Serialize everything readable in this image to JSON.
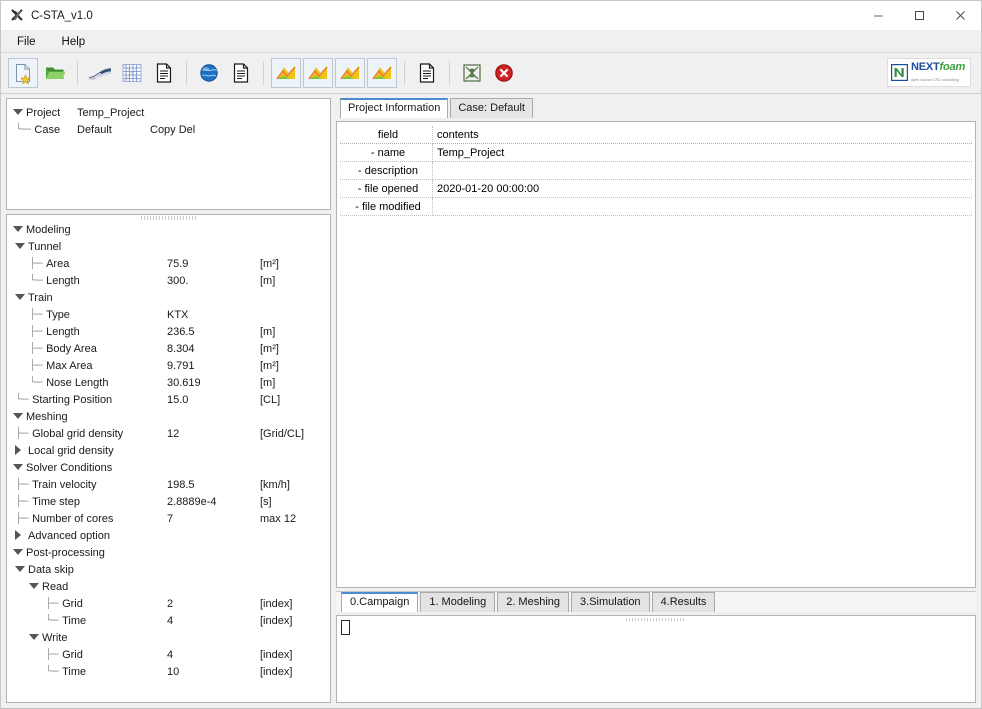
{
  "window": {
    "title": "C-STA_v1.0",
    "app_icon": "app-icon",
    "minimize": "minimize-icon",
    "maximize": "maximize-icon",
    "close": "close-icon"
  },
  "menubar": {
    "items": [
      {
        "label": "File"
      },
      {
        "label": "Help"
      }
    ]
  },
  "toolbar": {
    "buttons": [
      {
        "icon": "new-project-icon",
        "title": "New"
      },
      {
        "icon": "open-folder-icon",
        "title": "Open"
      },
      {
        "icon": "train-icon",
        "title": "Train"
      },
      {
        "icon": "mesh-grid-icon",
        "title": "Mesh"
      },
      {
        "icon": "document-icon",
        "title": "Document"
      },
      {
        "icon": "globe-icon",
        "title": "Run"
      },
      {
        "icon": "document-icon",
        "title": "Report"
      },
      {
        "icon": "chart-icon",
        "title": "Plot 1"
      },
      {
        "icon": "chart-icon",
        "title": "Plot 2"
      },
      {
        "icon": "chart-icon",
        "title": "Plot 3"
      },
      {
        "icon": "chart-icon",
        "title": "Plot 4"
      },
      {
        "icon": "document-icon",
        "title": "Log"
      },
      {
        "icon": "paraview-icon",
        "title": "ParaView"
      },
      {
        "icon": "stop-icon",
        "title": "Stop"
      }
    ],
    "brand": {
      "name_1": "NEXT",
      "name_2": "foam",
      "tagline": "open source CFD consulting"
    }
  },
  "project_tree": {
    "rows": [
      {
        "marker": "down",
        "label": "Project",
        "value": "Temp_Project"
      },
      {
        "marker": "leaf",
        "label": "Case",
        "value": "Default",
        "actions": "Copy  Del"
      }
    ]
  },
  "model_tree": {
    "rows": [
      {
        "indent": 0,
        "marker": "down",
        "label": "Modeling",
        "value": "",
        "unit": ""
      },
      {
        "indent": 1,
        "marker": "down",
        "label": "Tunnel",
        "value": "",
        "unit": ""
      },
      {
        "indent": 2,
        "marker": "leaf",
        "label": "Area",
        "value": "75.9",
        "unit": "[m²]"
      },
      {
        "indent": 2,
        "marker": "leaf-end",
        "label": "Length",
        "value": "300.",
        "unit": "[m]"
      },
      {
        "indent": 1,
        "marker": "down",
        "label": "Train",
        "value": "",
        "unit": ""
      },
      {
        "indent": 2,
        "marker": "leaf",
        "label": "Type",
        "value": "KTX",
        "unit": ""
      },
      {
        "indent": 2,
        "marker": "leaf",
        "label": "Length",
        "value": "236.5",
        "unit": "[m]"
      },
      {
        "indent": 2,
        "marker": "leaf",
        "label": "Body Area",
        "value": "8.304",
        "unit": "[m²]"
      },
      {
        "indent": 2,
        "marker": "leaf",
        "label": "Max Area",
        "value": "9.791",
        "unit": "[m²]"
      },
      {
        "indent": 2,
        "marker": "leaf-end",
        "label": "Nose Length",
        "value": "30.619",
        "unit": "[m]"
      },
      {
        "indent": 1,
        "marker": "leaf-end",
        "label": "Starting Position",
        "value": "15.0",
        "unit": "[CL]"
      },
      {
        "indent": 0,
        "marker": "down",
        "label": "Meshing",
        "value": "",
        "unit": ""
      },
      {
        "indent": 1,
        "marker": "leaf",
        "label": "Global grid density",
        "value": "12",
        "unit": "[Grid/CL]"
      },
      {
        "indent": 1,
        "marker": "right",
        "label": "Local grid density",
        "value": "",
        "unit": ""
      },
      {
        "indent": 0,
        "marker": "down",
        "label": "Solver Conditions",
        "value": "",
        "unit": ""
      },
      {
        "indent": 1,
        "marker": "leaf",
        "label": "Train velocity",
        "value": "198.5",
        "unit": "[km/h]"
      },
      {
        "indent": 1,
        "marker": "leaf",
        "label": "Time step",
        "value": "2.8889e-4",
        "unit": "[s]"
      },
      {
        "indent": 1,
        "marker": "leaf",
        "label": "Number of cores",
        "value": "7",
        "unit": "max 12"
      },
      {
        "indent": 1,
        "marker": "right",
        "label": "Advanced option",
        "value": "",
        "unit": ""
      },
      {
        "indent": 0,
        "marker": "down",
        "label": "Post-processing",
        "value": "",
        "unit": ""
      },
      {
        "indent": 1,
        "marker": "down",
        "label": "Data skip",
        "value": "",
        "unit": ""
      },
      {
        "indent": 2,
        "marker": "down",
        "label": "Read",
        "value": "",
        "unit": ""
      },
      {
        "indent": 3,
        "marker": "leaf",
        "label": "Grid",
        "value": "2",
        "unit": "[index]"
      },
      {
        "indent": 3,
        "marker": "leaf-end",
        "label": "Time",
        "value": "4",
        "unit": "[index]"
      },
      {
        "indent": 2,
        "marker": "down",
        "label": "Write",
        "value": "",
        "unit": ""
      },
      {
        "indent": 3,
        "marker": "leaf",
        "label": "Grid",
        "value": "4",
        "unit": "[index]"
      },
      {
        "indent": 3,
        "marker": "leaf-end",
        "label": "Time",
        "value": "10",
        "unit": "[index]"
      }
    ]
  },
  "main": {
    "tabs": [
      {
        "label": "Project Information",
        "active": true
      },
      {
        "label": "Case: Default",
        "active": false
      }
    ],
    "table": {
      "headers": [
        "field",
        "contents"
      ],
      "rows": [
        {
          "field": "- name",
          "contents": "Temp_Project"
        },
        {
          "field": "- description",
          "contents": ""
        },
        {
          "field": "- file opened",
          "contents": "2020-01-20 00:00:00"
        },
        {
          "field": "- file modified",
          "contents": ""
        }
      ]
    }
  },
  "stage_tabs": {
    "items": [
      {
        "label": "0.Campaign",
        "active": true
      },
      {
        "label": "1. Modeling",
        "active": false
      },
      {
        "label": "2. Meshing",
        "active": false
      },
      {
        "label": "3.Simulation",
        "active": false
      },
      {
        "label": "4.Results",
        "active": false
      }
    ]
  },
  "console": {
    "text": ""
  },
  "colors": {
    "accent": "#4f8ad0",
    "brand_blue": "#1b4f9c",
    "brand_green": "#3aa03a",
    "stop_red": "#cc2222"
  }
}
